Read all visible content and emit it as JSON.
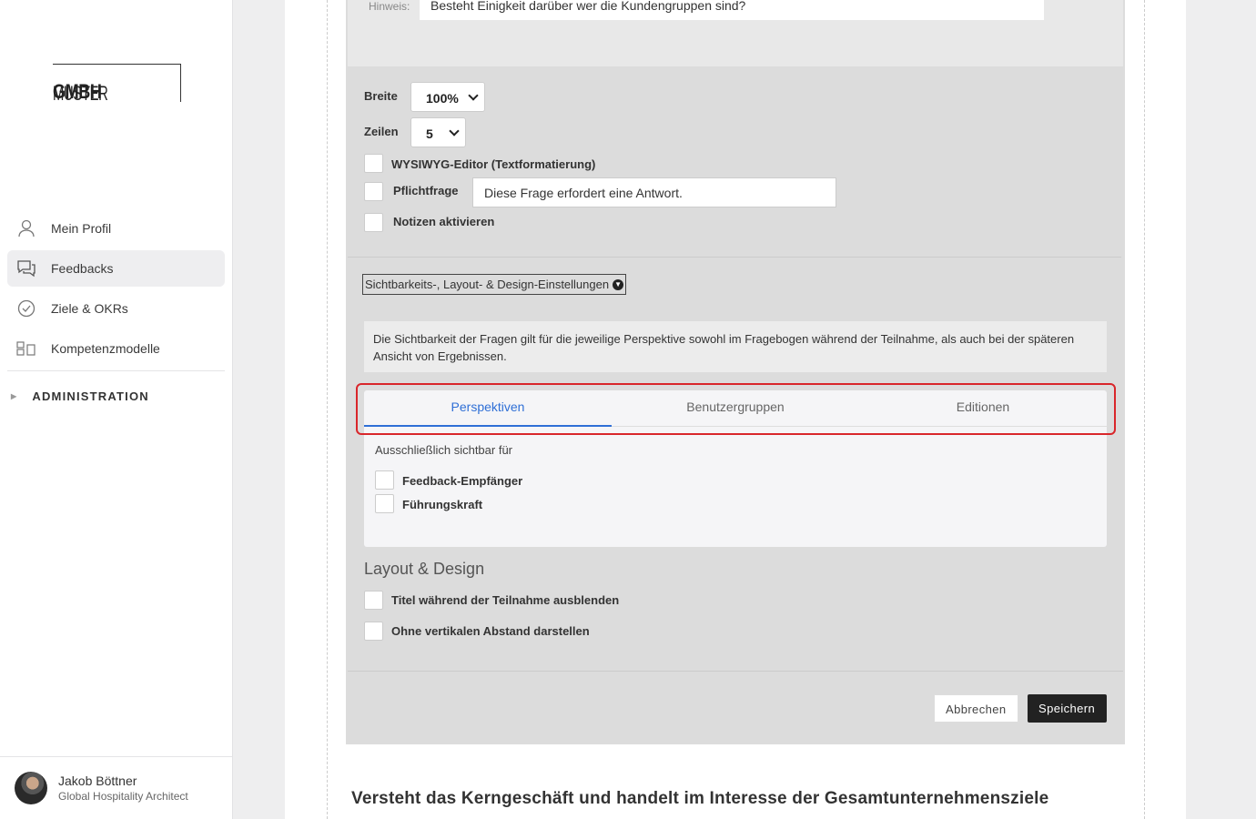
{
  "brand": {
    "logo_light": "MUSTER",
    "logo_bold": "GMBH"
  },
  "sidebar": {
    "items": [
      {
        "label": "Mein Profil",
        "icon": "user-icon"
      },
      {
        "label": "Feedbacks",
        "icon": "chat-icon"
      },
      {
        "label": "Ziele & OKRs",
        "icon": "check-circle-icon"
      },
      {
        "label": "Kompetenzmodelle",
        "icon": "blocks-icon"
      }
    ],
    "admin_label": "ADMINISTRATION",
    "user": {
      "name": "Jakob Böttner",
      "role": "Global Hospitality Architect"
    }
  },
  "editor": {
    "hint_label": "Hinweis:",
    "hint_value": "Besteht Einigkeit darüber wer die Kundengruppen sind?",
    "width_label": "Breite",
    "width_value": "100%",
    "rows_label": "Zeilen",
    "rows_value": "5",
    "wysiwyg_label": "WYSIWYG-Editor (Textformatierung)",
    "required_label": "Pflichtfrage",
    "required_message": "Diese Frage erfordert eine Antwort.",
    "notes_label": "Notizen aktivieren",
    "settings_toggle": "Sichtbarkeits-, Layout- & Design-Einstellungen",
    "visibility_info": "Die Sichtbarkeit der Fragen gilt für die jeweilige Perspektive sowohl im Fragebogen während der Teilnahme, als auch bei der späteren Ansicht von Ergebnissen.",
    "tabs": [
      "Perspektiven",
      "Benutzergruppen",
      "Editionen"
    ],
    "exclusive_label": "Ausschließlich sichtbar für",
    "perspectives": [
      "Feedback-Empfänger",
      "Führungskraft"
    ],
    "layout_title": "Layout & Design",
    "hide_title_label": "Titel während der Teilnahme ausblenden",
    "no_spacing_label": "Ohne vertikalen Abstand darstellen",
    "cancel_label": "Abbrechen",
    "save_label": "Speichern"
  },
  "next_question": "Versteht das Kerngeschäft und handelt im Interesse der Gesamtunternehmensziele",
  "colors": {
    "accent": "#2f6fd6",
    "highlight": "#d9262b",
    "save_button": "#222222"
  }
}
